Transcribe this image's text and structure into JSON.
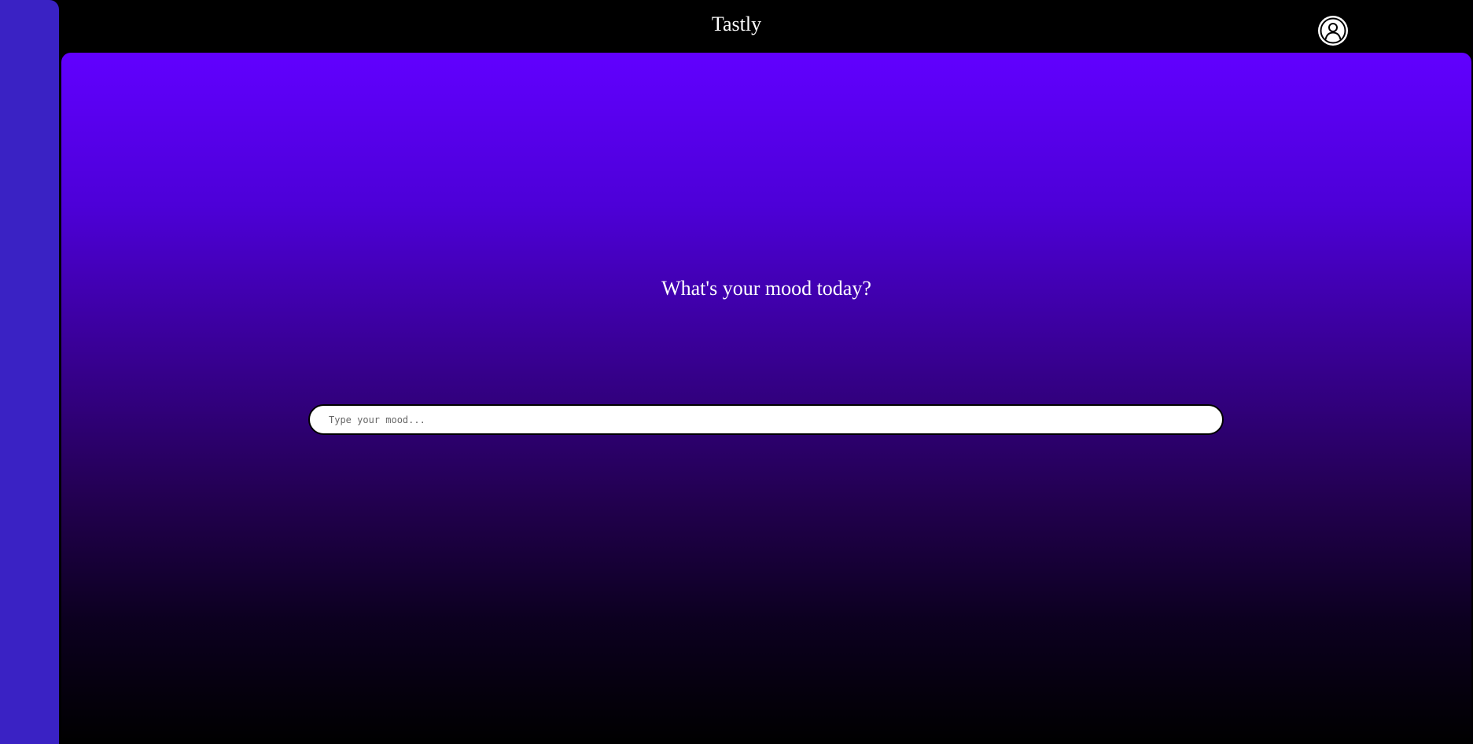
{
  "app": {
    "title": "Tastly"
  },
  "header": {
    "profile_icon": "user-circle-icon"
  },
  "main": {
    "heading": "What's your mood today?",
    "mood_input": {
      "value": "",
      "placeholder": "Type your mood..."
    }
  },
  "colors": {
    "sidebar": "#3a22c4",
    "gradient_top": "#6100ff",
    "gradient_bottom": "#000000",
    "background": "#000000",
    "text": "#ffffff"
  }
}
